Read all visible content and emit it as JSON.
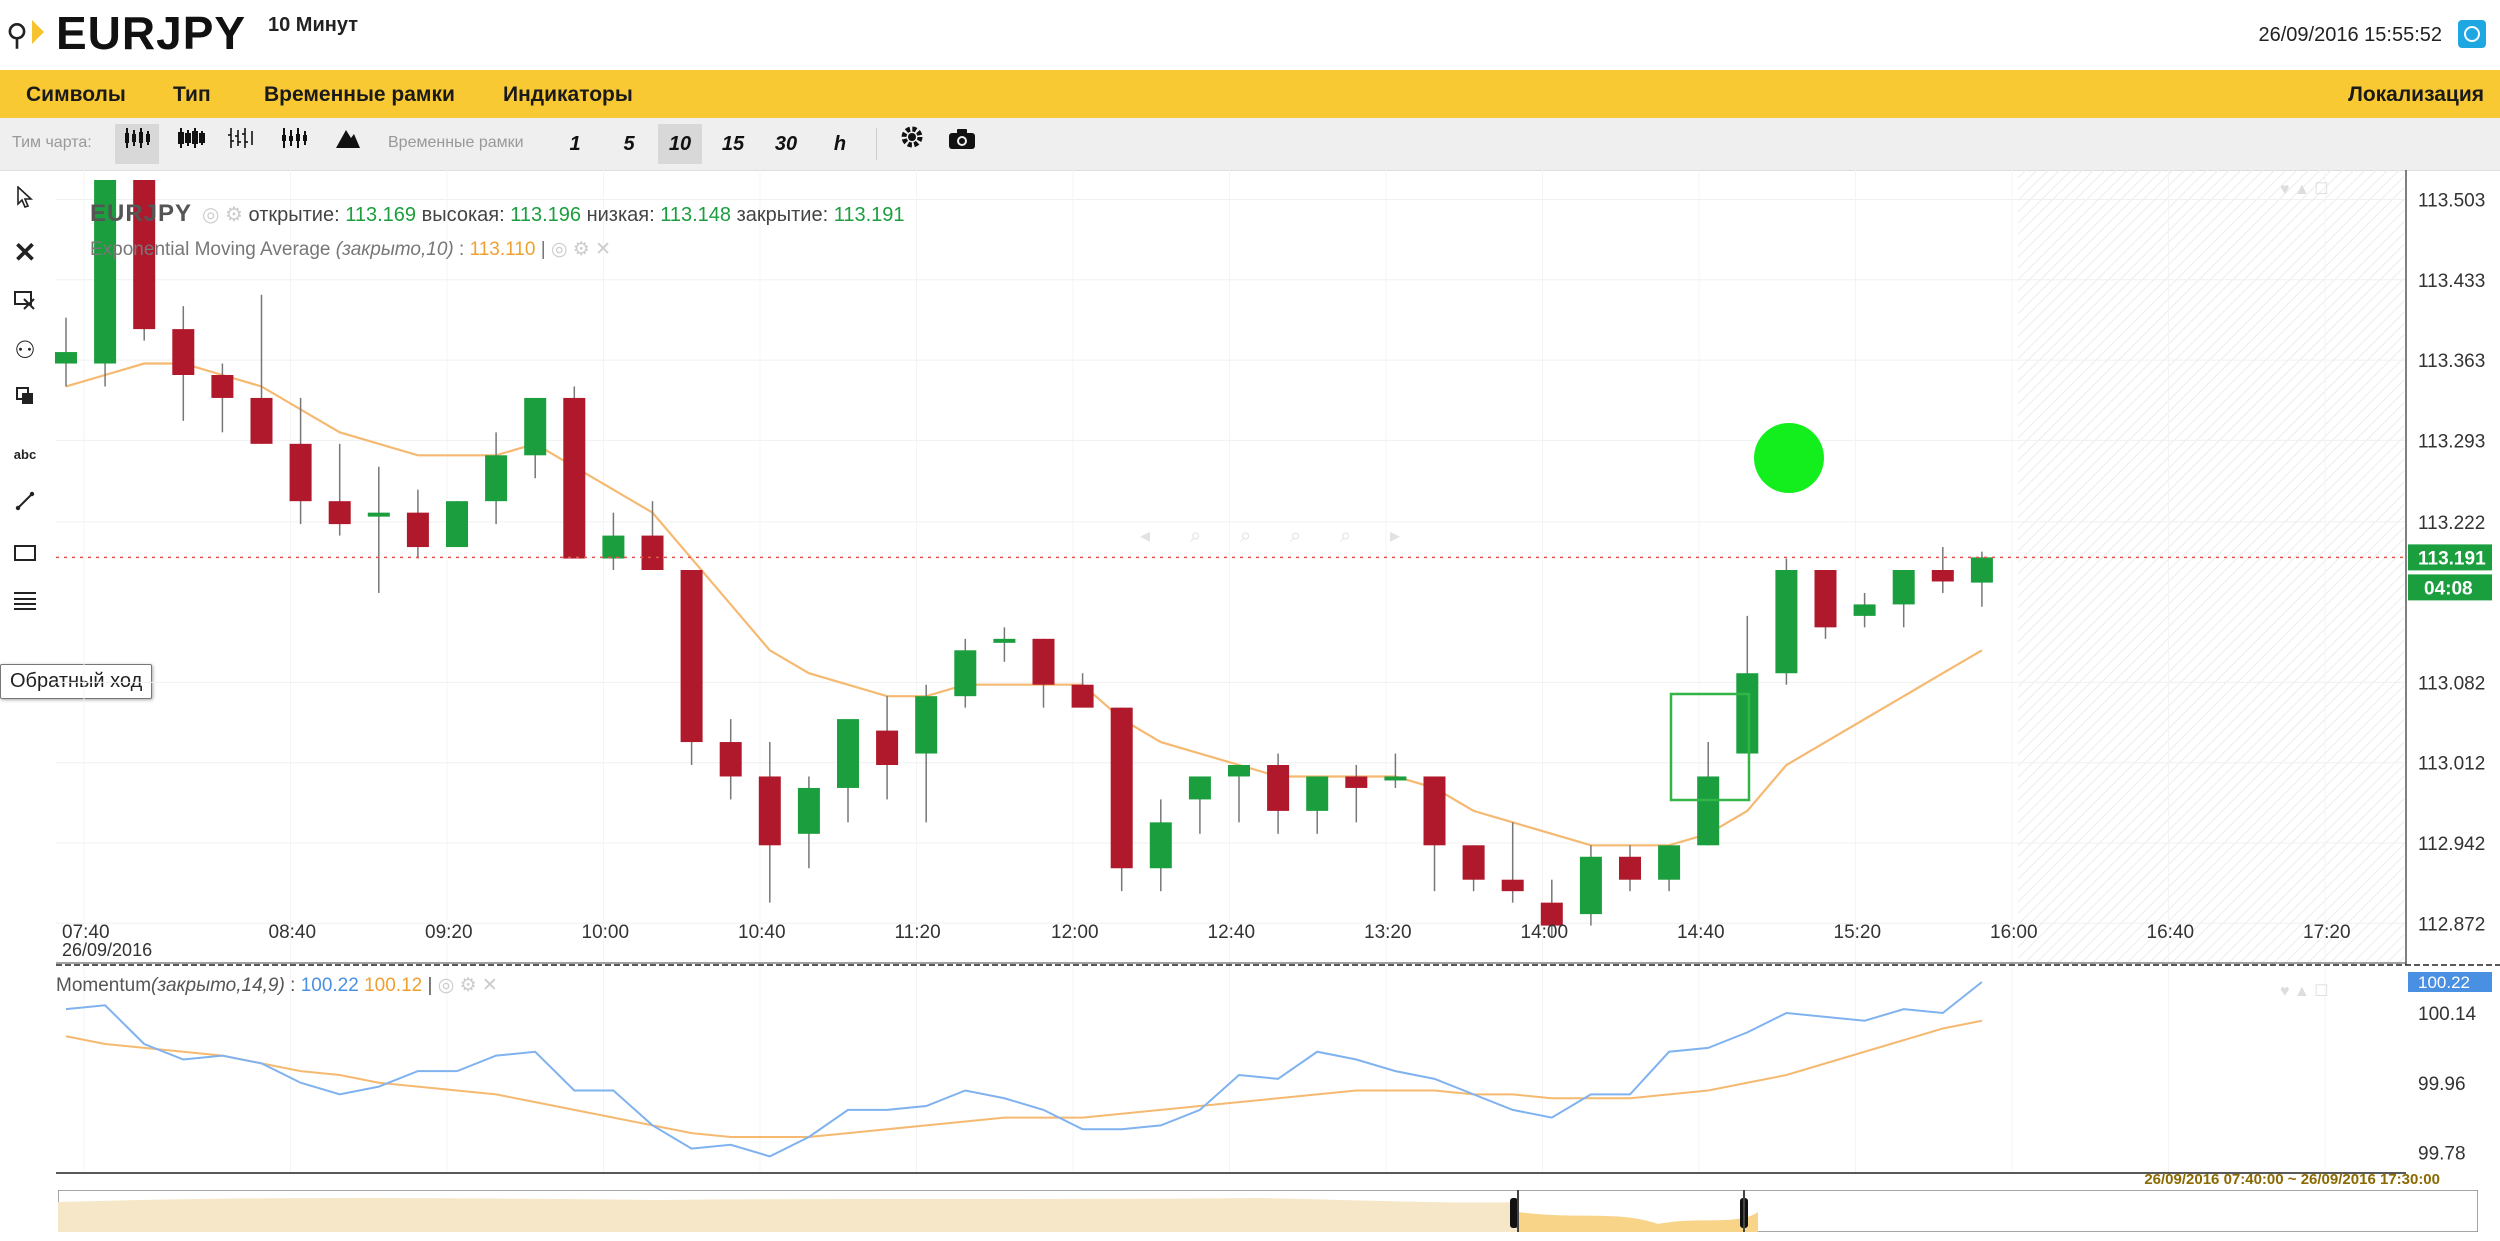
{
  "header": {
    "symbol": "EURJPY",
    "timeframe": "10 Минут",
    "datetime": "26/09/2016 15:55:52"
  },
  "menu": [
    "Символы",
    "Тип",
    "Временные рамки",
    "Индикаторы"
  ],
  "menu_right": "Локализация",
  "toolbar": {
    "chart_type_label": "Тим чарта:",
    "chart_type_icons": [
      "candles-icon",
      "bars-icon",
      "hollow-candles-icon",
      "heikin-ashi-icon",
      "area-icon"
    ],
    "timeframe_label": "Временные рамки",
    "timeframes": [
      "1",
      "5",
      "10",
      "15",
      "30",
      "h"
    ],
    "active_timeframe": "10"
  },
  "sidebar_tools": [
    "cursor-icon",
    "delete-icon",
    "select-delete-icon",
    "magnet-icon",
    "clone-icon",
    "text-tool-icon",
    "line-tool-icon",
    "rectangle-tool-icon",
    "fibonacci-tool-icon"
  ],
  "sidebar_text_tool": "abc",
  "tooltip": "Обратный ход",
  "legend": {
    "symbol": "EURJPY",
    "open_label": "открытие:",
    "open": "113.169",
    "high_label": "высокая:",
    "high": "113.196",
    "low_label": "низкая:",
    "low": "113.148",
    "close_label": "закрытие:",
    "close": "113.191",
    "ema_label": "Exponential Moving Average",
    "ema_params": "(закрыто,10)",
    "ema_value": "113.110",
    "momentum_label": "Momentum",
    "momentum_params": "(закрыто,14,9)",
    "momentum_value": "100.22",
    "momentum_signal": "100.12"
  },
  "price_axis": [
    "113.503",
    "113.433",
    "113.363",
    "113.293",
    "113.222",
    "113.082",
    "113.012",
    "112.942",
    "112.872"
  ],
  "price_badge": "113.191",
  "countdown_badge": "04:08",
  "momentum_axis": [
    "100.14",
    "99.96",
    "99.78"
  ],
  "momentum_badge": "100.22",
  "time_axis": [
    "07:40",
    "08:40",
    "09:20",
    "10:00",
    "10:40",
    "11:20",
    "12:00",
    "12:40",
    "13:20",
    "14:00",
    "14:40",
    "15:20",
    "16:00",
    "16:40",
    "17:20"
  ],
  "date_label": "26/09/2016",
  "navigator_range": "26/09/2016 07:40:00 ~ 26/09/2016 17:30:00",
  "colors": {
    "up": "#1b9e3e",
    "down": "#b0182b",
    "ema": "#f5b971",
    "momentum": "#7fb2ef",
    "menubar": "#f9c933",
    "badge": "#1b9e3e"
  },
  "chart_data": {
    "type": "candlestick",
    "timeframe": "10 Минут",
    "ylim": [
      112.84,
      113.52
    ],
    "candles": [
      {
        "o": 113.36,
        "h": 113.4,
        "l": 113.34,
        "c": 113.37
      },
      {
        "o": 113.36,
        "h": 113.52,
        "l": 113.34,
        "c": 113.52
      },
      {
        "o": 113.52,
        "h": 113.52,
        "l": 113.38,
        "c": 113.39
      },
      {
        "o": 113.39,
        "h": 113.41,
        "l": 113.31,
        "c": 113.35
      },
      {
        "o": 113.35,
        "h": 113.36,
        "l": 113.3,
        "c": 113.33
      },
      {
        "o": 113.33,
        "h": 113.42,
        "l": 113.29,
        "c": 113.29
      },
      {
        "o": 113.29,
        "h": 113.33,
        "l": 113.22,
        "c": 113.24
      },
      {
        "o": 113.24,
        "h": 113.29,
        "l": 113.21,
        "c": 113.22
      },
      {
        "o": 113.23,
        "h": 113.27,
        "l": 113.16,
        "c": 113.23
      },
      {
        "o": 113.23,
        "h": 113.25,
        "l": 113.19,
        "c": 113.2
      },
      {
        "o": 113.2,
        "h": 113.24,
        "l": 113.2,
        "c": 113.24
      },
      {
        "o": 113.24,
        "h": 113.3,
        "l": 113.22,
        "c": 113.28
      },
      {
        "o": 113.28,
        "h": 113.33,
        "l": 113.26,
        "c": 113.33
      },
      {
        "o": 113.33,
        "h": 113.34,
        "l": 113.19,
        "c": 113.19
      },
      {
        "o": 113.19,
        "h": 113.23,
        "l": 113.18,
        "c": 113.21
      },
      {
        "o": 113.21,
        "h": 113.24,
        "l": 113.18,
        "c": 113.18
      },
      {
        "o": 113.18,
        "h": 113.18,
        "l": 113.01,
        "c": 113.03
      },
      {
        "o": 113.03,
        "h": 113.05,
        "l": 112.98,
        "c": 113.0
      },
      {
        "o": 113.0,
        "h": 113.03,
        "l": 112.89,
        "c": 112.94
      },
      {
        "o": 112.95,
        "h": 113.0,
        "l": 112.92,
        "c": 112.99
      },
      {
        "o": 112.99,
        "h": 113.05,
        "l": 112.96,
        "c": 113.05
      },
      {
        "o": 113.04,
        "h": 113.07,
        "l": 112.98,
        "c": 113.01
      },
      {
        "o": 113.02,
        "h": 113.08,
        "l": 112.96,
        "c": 113.07
      },
      {
        "o": 113.07,
        "h": 113.12,
        "l": 113.06,
        "c": 113.11
      },
      {
        "o": 113.12,
        "h": 113.13,
        "l": 113.1,
        "c": 113.12
      },
      {
        "o": 113.12,
        "h": 113.12,
        "l": 113.06,
        "c": 113.08
      },
      {
        "o": 113.08,
        "h": 113.09,
        "l": 113.06,
        "c": 113.06
      },
      {
        "o": 113.06,
        "h": 113.06,
        "l": 112.9,
        "c": 112.92
      },
      {
        "o": 112.92,
        "h": 112.98,
        "l": 112.9,
        "c": 112.96
      },
      {
        "o": 112.98,
        "h": 113.0,
        "l": 112.95,
        "c": 113.0
      },
      {
        "o": 113.0,
        "h": 113.0,
        "l": 112.96,
        "c": 113.01
      },
      {
        "o": 113.01,
        "h": 113.02,
        "l": 112.95,
        "c": 112.97
      },
      {
        "o": 112.97,
        "h": 113.0,
        "l": 112.95,
        "c": 113.0
      },
      {
        "o": 113.0,
        "h": 113.01,
        "l": 112.96,
        "c": 112.99
      },
      {
        "o": 113.0,
        "h": 113.02,
        "l": 112.99,
        "c": 113.0
      },
      {
        "o": 113.0,
        "h": 113.0,
        "l": 112.9,
        "c": 112.94
      },
      {
        "o": 112.94,
        "h": 112.94,
        "l": 112.9,
        "c": 112.91
      },
      {
        "o": 112.91,
        "h": 112.96,
        "l": 112.89,
        "c": 112.9
      },
      {
        "o": 112.89,
        "h": 112.91,
        "l": 112.86,
        "c": 112.87
      },
      {
        "o": 112.88,
        "h": 112.94,
        "l": 112.87,
        "c": 112.93
      },
      {
        "o": 112.93,
        "h": 112.94,
        "l": 112.9,
        "c": 112.91
      },
      {
        "o": 112.91,
        "h": 112.94,
        "l": 112.9,
        "c": 112.94
      },
      {
        "o": 112.94,
        "h": 113.03,
        "l": 112.94,
        "c": 113.0
      },
      {
        "o": 113.02,
        "h": 113.14,
        "l": 113.02,
        "c": 113.09
      },
      {
        "o": 113.09,
        "h": 113.19,
        "l": 113.08,
        "c": 113.18
      },
      {
        "o": 113.18,
        "h": 113.18,
        "l": 113.12,
        "c": 113.13
      },
      {
        "o": 113.14,
        "h": 113.16,
        "l": 113.13,
        "c": 113.15
      },
      {
        "o": 113.15,
        "h": 113.18,
        "l": 113.13,
        "c": 113.18
      },
      {
        "o": 113.18,
        "h": 113.2,
        "l": 113.16,
        "c": 113.17
      },
      {
        "o": 113.169,
        "h": 113.196,
        "l": 113.148,
        "c": 113.191
      }
    ],
    "ema": [
      113.34,
      113.35,
      113.36,
      113.36,
      113.35,
      113.34,
      113.32,
      113.3,
      113.29,
      113.28,
      113.28,
      113.28,
      113.29,
      113.27,
      113.25,
      113.23,
      113.19,
      113.15,
      113.11,
      113.09,
      113.08,
      113.07,
      113.07,
      113.08,
      113.08,
      113.08,
      113.08,
      113.05,
      113.03,
      113.02,
      113.01,
      113.0,
      113.0,
      113.0,
      113.0,
      112.99,
      112.97,
      112.96,
      112.95,
      112.94,
      112.94,
      112.94,
      112.95,
      112.97,
      113.01,
      113.03,
      113.05,
      113.07,
      113.09,
      113.11
    ],
    "momentum": [
      100.15,
      100.16,
      100.06,
      100.02,
      100.03,
      100.01,
      99.96,
      99.93,
      99.95,
      99.99,
      99.99,
      100.03,
      100.04,
      99.94,
      99.94,
      99.85,
      99.79,
      99.8,
      99.77,
      99.82,
      99.89,
      99.89,
      99.9,
      99.94,
      99.92,
      99.89,
      99.84,
      99.84,
      99.85,
      99.89,
      99.98,
      99.97,
      100.04,
      100.02,
      99.99,
      99.97,
      99.93,
      99.89,
      99.87,
      99.93,
      99.93,
      100.04,
      100.05,
      100.09,
      100.14,
      100.13,
      100.12,
      100.15,
      100.14,
      100.22
    ],
    "momentum_signal": [
      100.08,
      100.06,
      100.05,
      100.04,
      100.03,
      100.01,
      99.99,
      99.98,
      99.96,
      99.95,
      99.94,
      99.93,
      99.91,
      99.89,
      99.87,
      99.85,
      99.83,
      99.82,
      99.82,
      99.82,
      99.83,
      99.84,
      99.85,
      99.86,
      99.87,
      99.87,
      99.87,
      99.88,
      99.89,
      99.9,
      99.91,
      99.92,
      99.93,
      99.94,
      99.94,
      99.94,
      99.93,
      99.93,
      99.92,
      99.92,
      99.92,
      99.93,
      99.94,
      99.96,
      99.98,
      100.01,
      100.04,
      100.07,
      100.1,
      100.12
    ],
    "momentum_ylim": [
      99.74,
      100.22
    ]
  }
}
